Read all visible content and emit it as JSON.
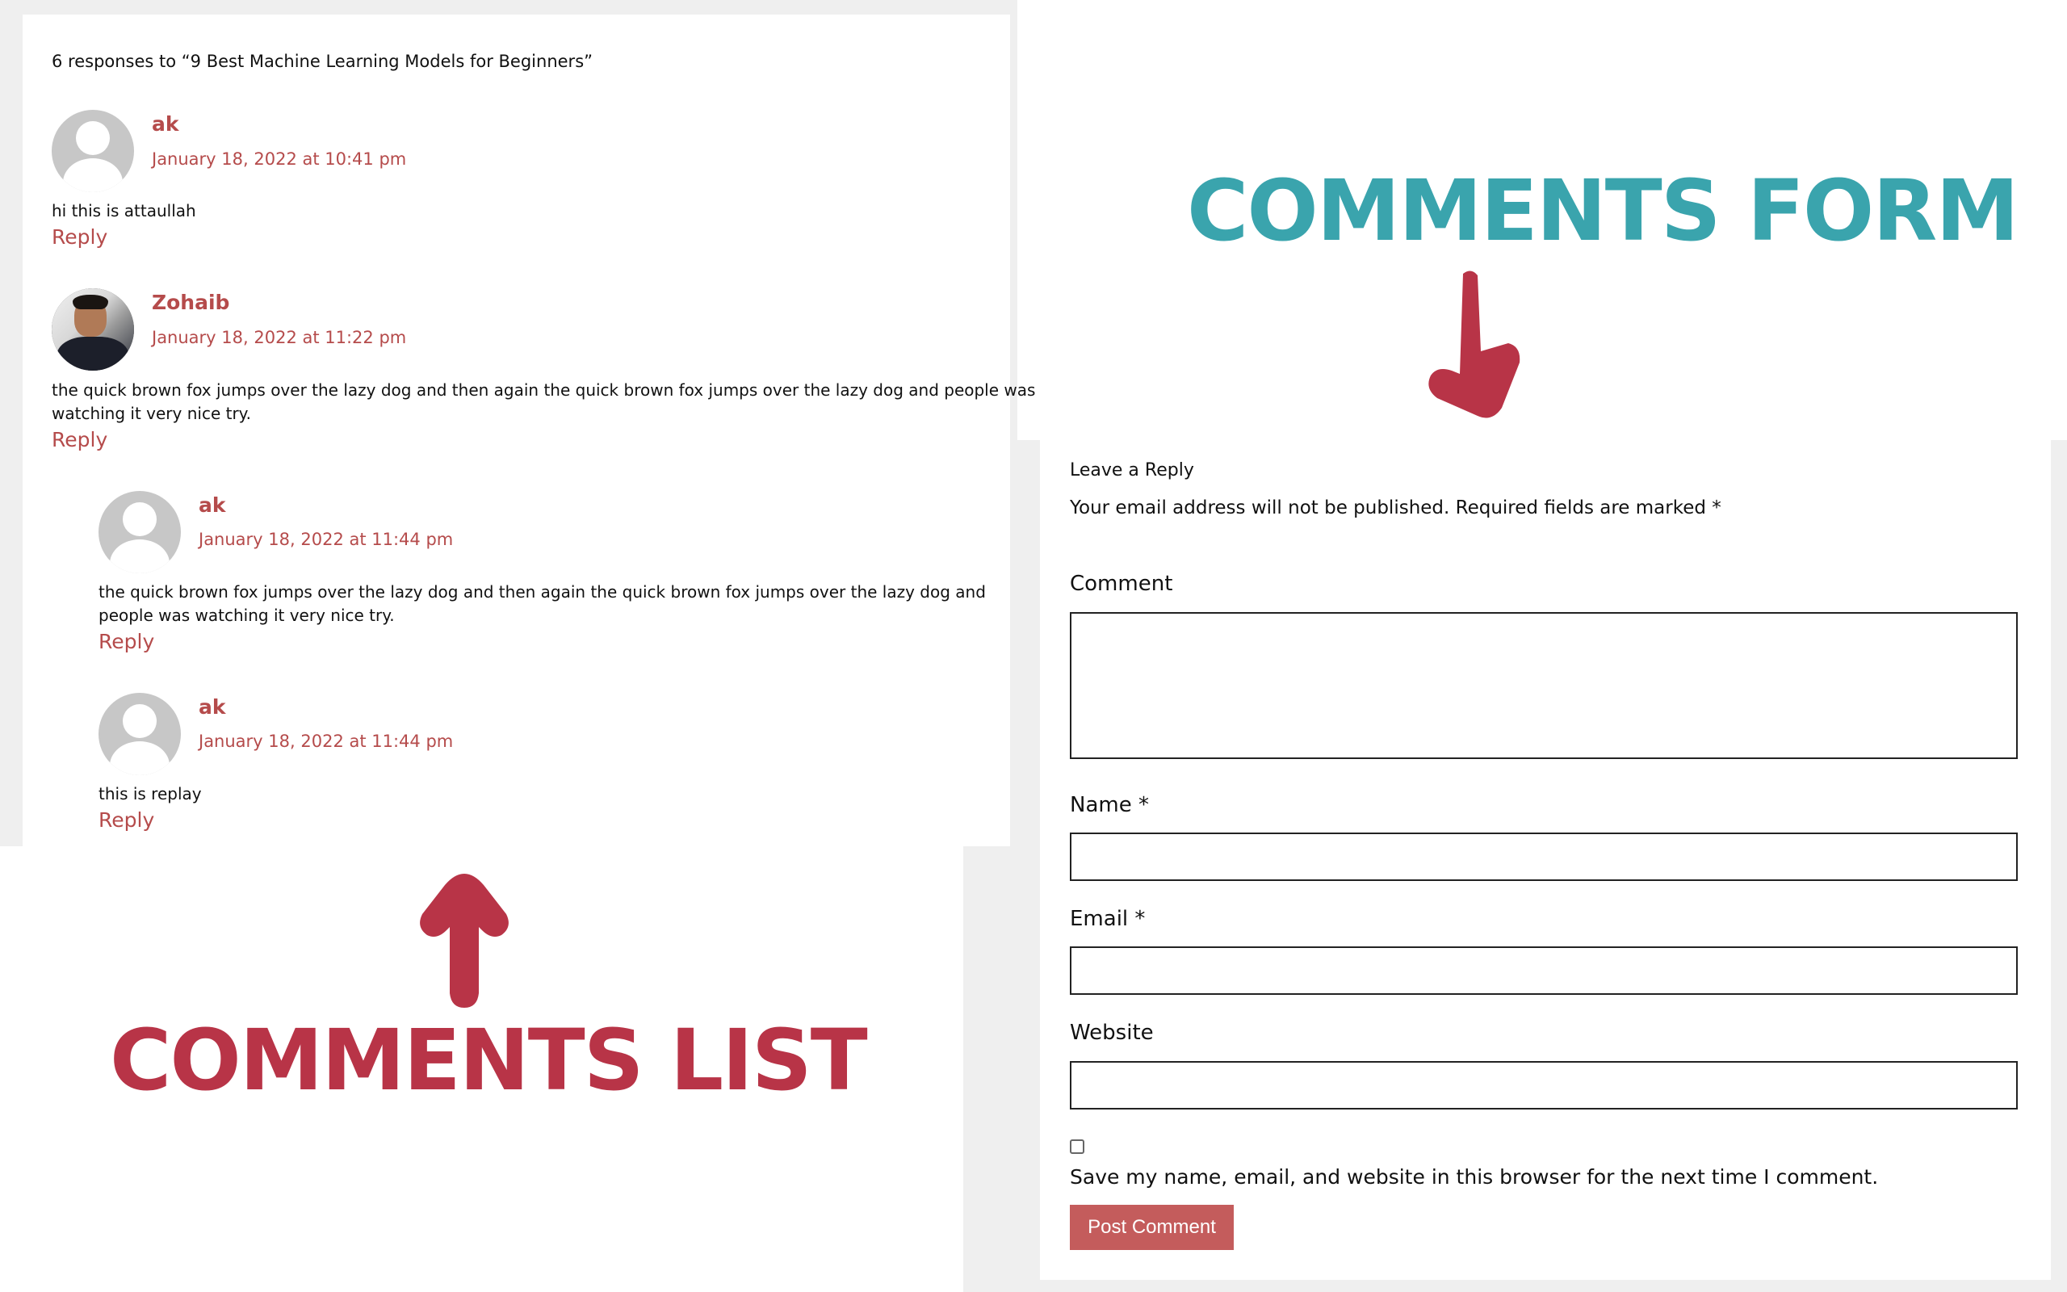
{
  "comments_section": {
    "title": "6 responses to “9 Best Machine Learning Models for Beginners”",
    "comments": [
      {
        "author": "ak",
        "date": "January 18, 2022 at 10:41 pm",
        "text": "hi this is attaullah",
        "reply": "Reply",
        "avatar": "default-avatar-icon"
      },
      {
        "author": "Zohaib",
        "date": "January 18, 2022 at 11:22 pm",
        "text_line1": "the quick brown fox jumps over the lazy dog and then again the quick brown fox jumps over the lazy dog and people was",
        "text_line2": "watching it very nice try.",
        "reply": "Reply",
        "avatar": "user-photo-avatar"
      },
      {
        "author": "ak",
        "date": "January 18, 2022 at 11:44 pm",
        "text_line1": "the quick brown fox jumps over the lazy dog and then again the quick brown fox jumps over the lazy dog and",
        "text_line2": "people was watching it very nice try.",
        "reply": "Reply",
        "avatar": "default-avatar-icon"
      },
      {
        "author": "ak",
        "date": "January 18, 2022 at 11:44 pm",
        "text": "this is replay",
        "reply": "Reply",
        "avatar": "default-avatar-icon"
      }
    ]
  },
  "annotations": {
    "form_label": "COMMENTS FORM",
    "list_label": "COMMENTS LIST",
    "form_color": "#3aa4ad",
    "list_color": "#b83447",
    "arrow_icon": "arrow-icon"
  },
  "form": {
    "heading": "Leave a Reply",
    "notice": "Your email address will not be published. Required fields are marked *",
    "comment_label": "Comment",
    "comment_value": "",
    "name_label": "Name *",
    "name_value": "",
    "email_label": "Email *",
    "email_value": "",
    "website_label": "Website",
    "website_value": "",
    "save_info_checked": false,
    "save_info_label": "Save my name, email, and website in this browser for the next time I comment.",
    "submit_label": "Post Comment",
    "accent_color": "#c45c5c"
  }
}
